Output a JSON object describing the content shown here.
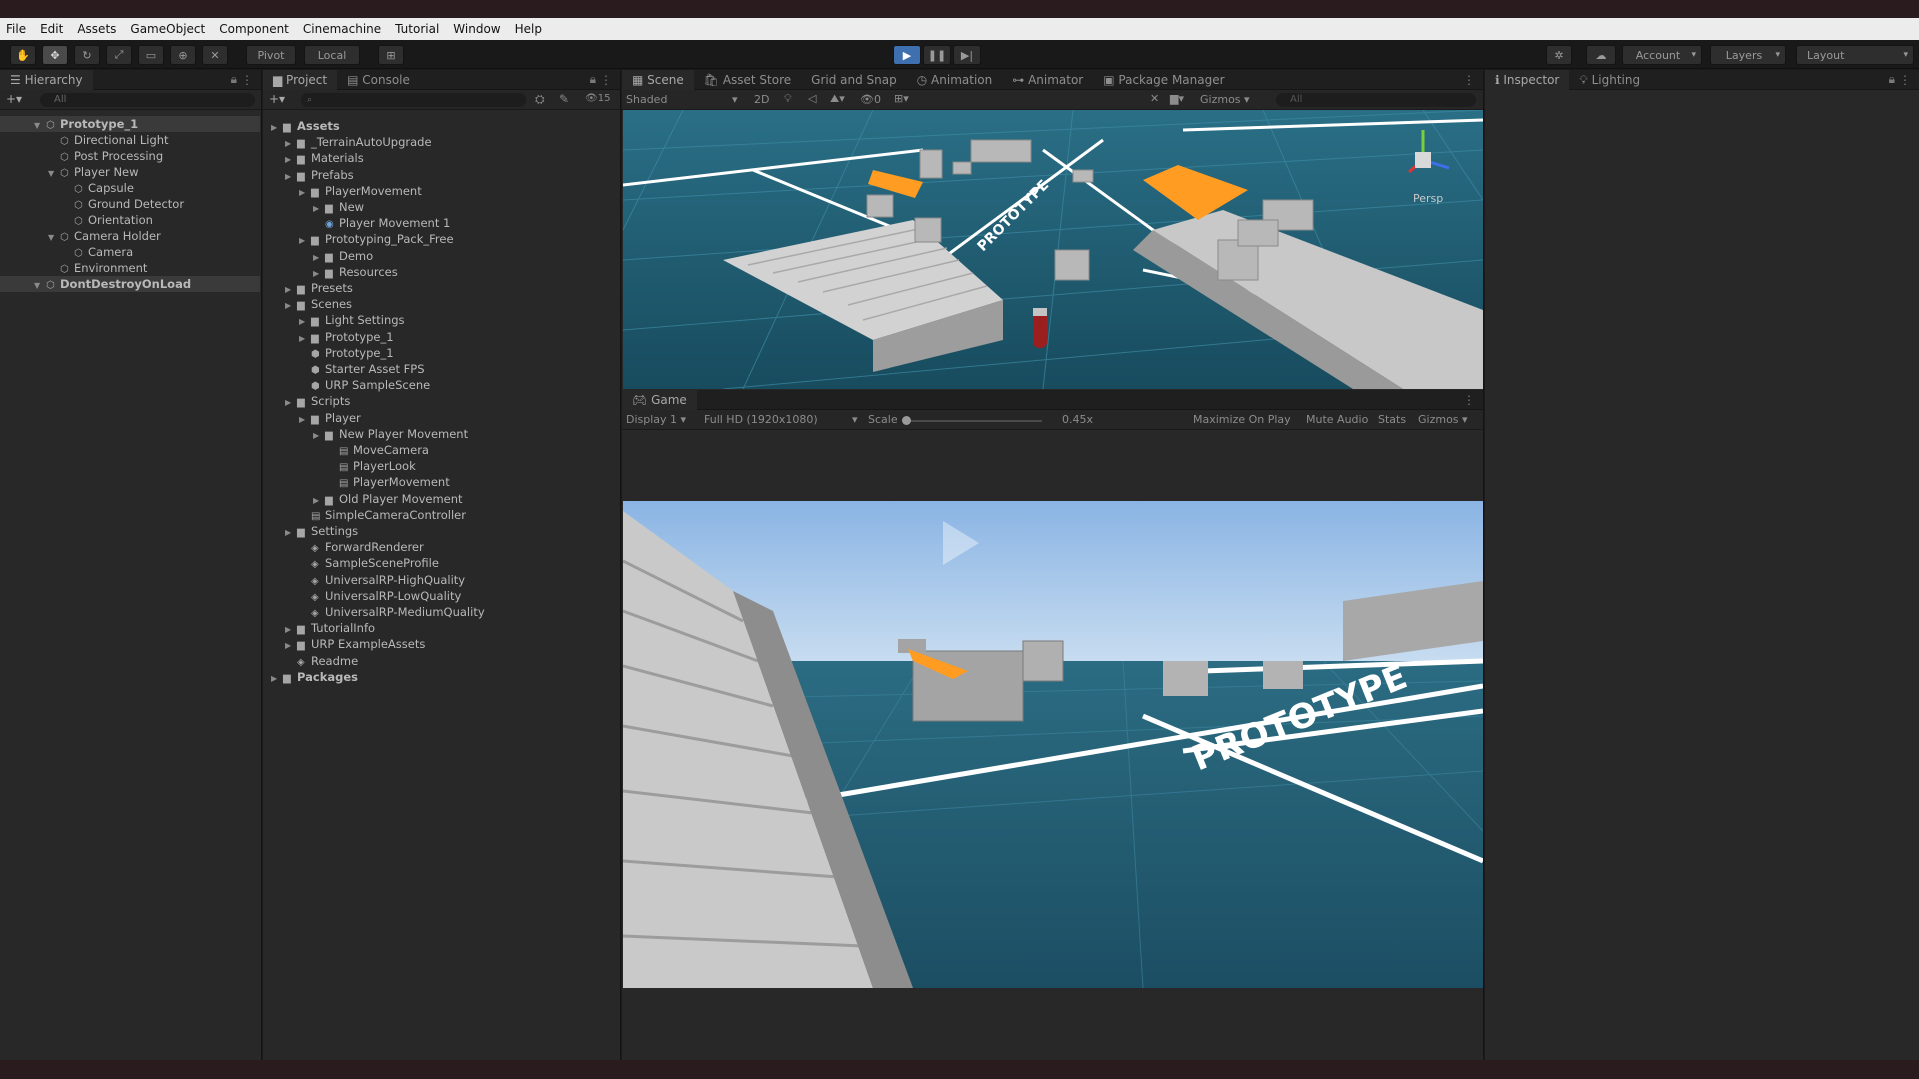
{
  "menu": [
    "File",
    "Edit",
    "Assets",
    "GameObject",
    "Component",
    "Cinemachine",
    "Tutorial",
    "Window",
    "Help"
  ],
  "toolbar": {
    "pivot": "Pivot",
    "local": "Local",
    "account": "Account",
    "layers": "Layers",
    "layout": "Layout"
  },
  "hierarchy": {
    "tab": "Hierarchy",
    "search_placeholder": "All",
    "items": [
      {
        "label": "Prototype_1",
        "depth": 0,
        "selected": true
      },
      {
        "label": "Directional Light",
        "depth": 1
      },
      {
        "label": "Post Processing",
        "depth": 1
      },
      {
        "label": "Player New",
        "depth": 1
      },
      {
        "label": "Capsule",
        "depth": 2
      },
      {
        "label": "Ground Detector",
        "depth": 2
      },
      {
        "label": "Orientation",
        "depth": 2
      },
      {
        "label": "Camera Holder",
        "depth": 1
      },
      {
        "label": "Camera",
        "depth": 2
      },
      {
        "label": "Environment",
        "depth": 1
      },
      {
        "label": "DontDestroyOnLoad",
        "depth": 0,
        "selected": true
      }
    ]
  },
  "project": {
    "tabs": [
      "Project",
      "Console"
    ],
    "hidden_count": "15",
    "items": [
      {
        "label": "Assets",
        "depth": 0,
        "type": "folder"
      },
      {
        "label": "_TerrainAutoUpgrade",
        "depth": 1,
        "type": "folder"
      },
      {
        "label": "Materials",
        "depth": 1,
        "type": "folder"
      },
      {
        "label": "Prefabs",
        "depth": 1,
        "type": "folder"
      },
      {
        "label": "PlayerMovement",
        "depth": 2,
        "type": "folder"
      },
      {
        "label": "New",
        "depth": 3,
        "type": "folder"
      },
      {
        "label": "Player Movement 1",
        "depth": 3,
        "type": "prefab"
      },
      {
        "label": "Prototyping_Pack_Free",
        "depth": 2,
        "type": "folder"
      },
      {
        "label": "Demo",
        "depth": 3,
        "type": "folder"
      },
      {
        "label": "Resources",
        "depth": 3,
        "type": "folder"
      },
      {
        "label": "Presets",
        "depth": 1,
        "type": "folder"
      },
      {
        "label": "Scenes",
        "depth": 1,
        "type": "folder"
      },
      {
        "label": "Light Settings",
        "depth": 2,
        "type": "folder"
      },
      {
        "label": "Prototype_1",
        "depth": 2,
        "type": "folder"
      },
      {
        "label": "Prototype_1",
        "depth": 2,
        "type": "scene"
      },
      {
        "label": "Starter Asset FPS",
        "depth": 2,
        "type": "scene"
      },
      {
        "label": "URP SampleScene",
        "depth": 2,
        "type": "scene"
      },
      {
        "label": "Scripts",
        "depth": 1,
        "type": "folder"
      },
      {
        "label": "Player",
        "depth": 2,
        "type": "folder"
      },
      {
        "label": "New Player Movement",
        "depth": 3,
        "type": "folder"
      },
      {
        "label": "MoveCamera",
        "depth": 4,
        "type": "script"
      },
      {
        "label": "PlayerLook",
        "depth": 4,
        "type": "script"
      },
      {
        "label": "PlayerMovement",
        "depth": 4,
        "type": "script"
      },
      {
        "label": "Old Player Movement",
        "depth": 3,
        "type": "folder"
      },
      {
        "label": "SimpleCameraController",
        "depth": 2,
        "type": "script"
      },
      {
        "label": "Settings",
        "depth": 1,
        "type": "folder"
      },
      {
        "label": "ForwardRenderer",
        "depth": 2,
        "type": "asset"
      },
      {
        "label": "SampleSceneProfile",
        "depth": 2,
        "type": "asset"
      },
      {
        "label": "UniversalRP-HighQuality",
        "depth": 2,
        "type": "asset"
      },
      {
        "label": "UniversalRP-LowQuality",
        "depth": 2,
        "type": "asset"
      },
      {
        "label": "UniversalRP-MediumQuality",
        "depth": 2,
        "type": "asset"
      },
      {
        "label": "TutorialInfo",
        "depth": 1,
        "type": "folder"
      },
      {
        "label": "URP ExampleAssets",
        "depth": 1,
        "type": "folder"
      },
      {
        "label": "Readme",
        "depth": 1,
        "type": "asset"
      },
      {
        "label": "Packages",
        "depth": 0,
        "type": "folder"
      }
    ]
  },
  "scene": {
    "tabs": [
      "Scene",
      "Asset Store",
      "Grid and Snap",
      "Animation",
      "Animator",
      "Package Manager"
    ],
    "shading": "Shaded",
    "mode_2d": "2D",
    "hidden_count": "0",
    "gizmos": "Gizmos",
    "search_placeholder": "All",
    "persp": "Persp",
    "floor_text": "PROTOTYPE"
  },
  "game": {
    "tab": "Game",
    "display": "Display 1",
    "resolution": "Full HD (1920x1080)",
    "scale_label": "Scale",
    "scale_value": "0.45x",
    "maximize": "Maximize On Play",
    "mute": "Mute Audio",
    "stats": "Stats",
    "gizmos": "Gizmos",
    "floor_text": "PROTOTYPE"
  },
  "inspector": {
    "tabs": [
      "Inspector",
      "Lighting"
    ]
  },
  "colors": {
    "sky_top": "#8bb6e6",
    "floor": "#1f5d73",
    "ramp": "#cfcfcf",
    "orange": "#ff9c21"
  }
}
